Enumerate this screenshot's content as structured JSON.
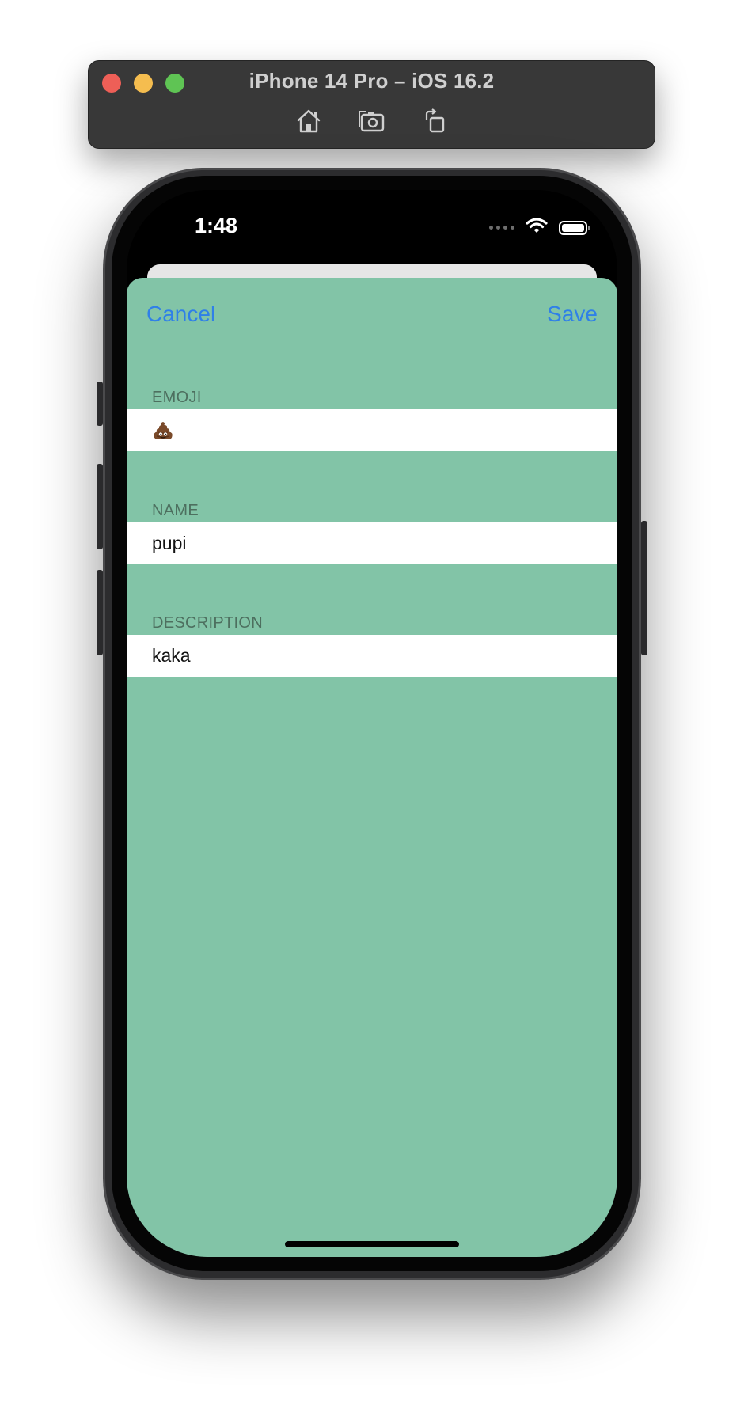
{
  "simulator": {
    "title": "iPhone 14 Pro – iOS 16.2",
    "toolbar_icons": [
      "home-icon",
      "screenshot-icon",
      "rotate-icon"
    ]
  },
  "status_bar": {
    "time": "1:48",
    "icons": [
      "cellular-dots-icon",
      "wifi-icon",
      "battery-icon"
    ]
  },
  "sheet": {
    "cancel_label": "Cancel",
    "save_label": "Save",
    "background_color": "#82c4a7",
    "accent_color": "#2f80e8",
    "fields": {
      "emoji": {
        "header": "EMOJI",
        "value": "💩"
      },
      "name": {
        "header": "NAME",
        "value": "pupi"
      },
      "description": {
        "header": "DESCRIPTION",
        "value": "kaka"
      }
    }
  }
}
